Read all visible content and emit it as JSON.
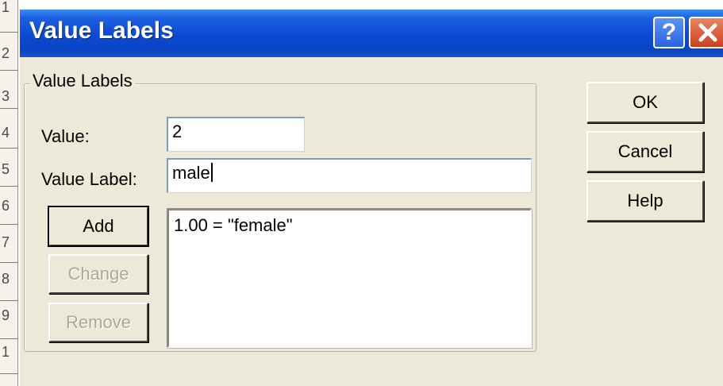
{
  "window": {
    "title": "Value Labels",
    "help_button": "?",
    "close_button": "✕"
  },
  "ruler": {
    "numbers": [
      "1",
      "2",
      "3",
      "4",
      "5",
      "6",
      "7",
      "8",
      "9",
      "1"
    ]
  },
  "group": {
    "label": "Value Labels"
  },
  "value_field": {
    "label": "Value:",
    "value": "2"
  },
  "value_label_field": {
    "label": "Value Label:",
    "value": "male"
  },
  "buttons": {
    "add": "Add",
    "change": "Change",
    "remove": "Remove",
    "ok": "OK",
    "cancel": "Cancel",
    "help": "Help"
  },
  "labels_list": {
    "items": [
      "1.00 = \"female\""
    ]
  },
  "colors": {
    "titlebar": "#0a49d2",
    "dialog_bg": "#ece9d8",
    "close_button": "#c9411f"
  }
}
